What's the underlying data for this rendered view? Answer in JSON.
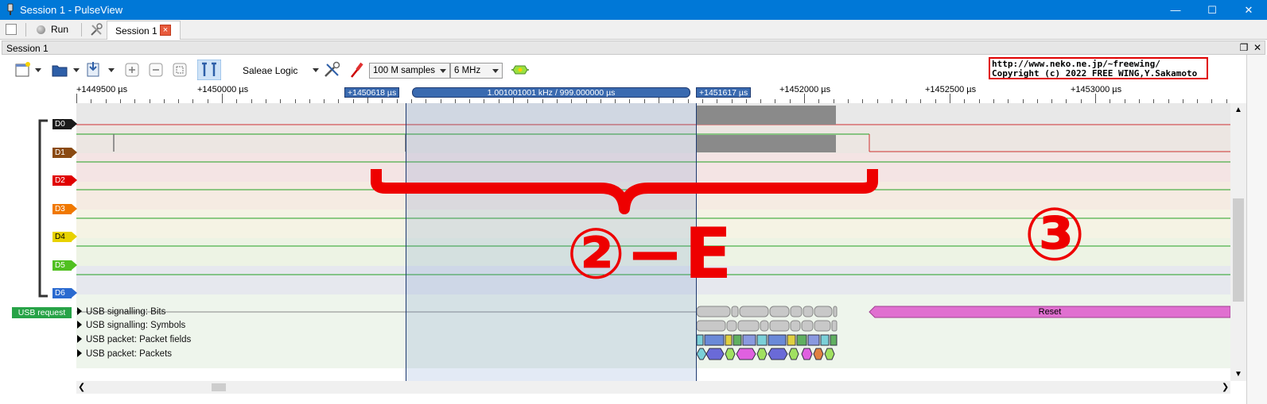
{
  "window": {
    "title": "Session 1 - PulseView",
    "minimize": "—",
    "maximize": "☐",
    "close": "✕"
  },
  "tabbar": {
    "run_label": "Run",
    "session_tab_label": "Session 1",
    "session_tab_close": "×"
  },
  "dock": {
    "title": "Session 1",
    "float_icon": "❐",
    "close_icon": "✕"
  },
  "toolbar": {
    "device": "Saleae Logic",
    "samples": "100 M samples",
    "samplerate": "6 MHz"
  },
  "copyright_text": "http://www.neko.ne.jp/~freewing/\nCopyright (c) 2022 FREE WING,Y.Sakamoto",
  "ruler": {
    "labels": [
      {
        "text": "+1449500 µs"
      },
      {
        "text": "+1450000 µs"
      },
      {
        "text": "+1452000 µs"
      },
      {
        "text": "+1452500 µs"
      },
      {
        "text": "+1453000 µs"
      }
    ]
  },
  "cursors": {
    "left": "+1450618 µs",
    "right": "+1451617 µs",
    "measurement": "1.001001001 kHz / 999.000000 µs"
  },
  "channels": [
    "D0",
    "D1",
    "D2",
    "D3",
    "D4",
    "D5",
    "D6"
  ],
  "channel_colors": [
    "#1a1a1a",
    "#8a4a12",
    "#e00000",
    "#f07800",
    "#e8d200",
    "#50c020",
    "#2a6ad0"
  ],
  "decoder": {
    "label": "USB request",
    "rows": [
      "USB signalling: Bits",
      "USB signalling: Symbols",
      "USB packet: Packet fields",
      "USB packet: Packets"
    ],
    "reset_label": "Reset"
  },
  "annotations": {
    "step_2e": "②−E",
    "step_3": "③"
  }
}
